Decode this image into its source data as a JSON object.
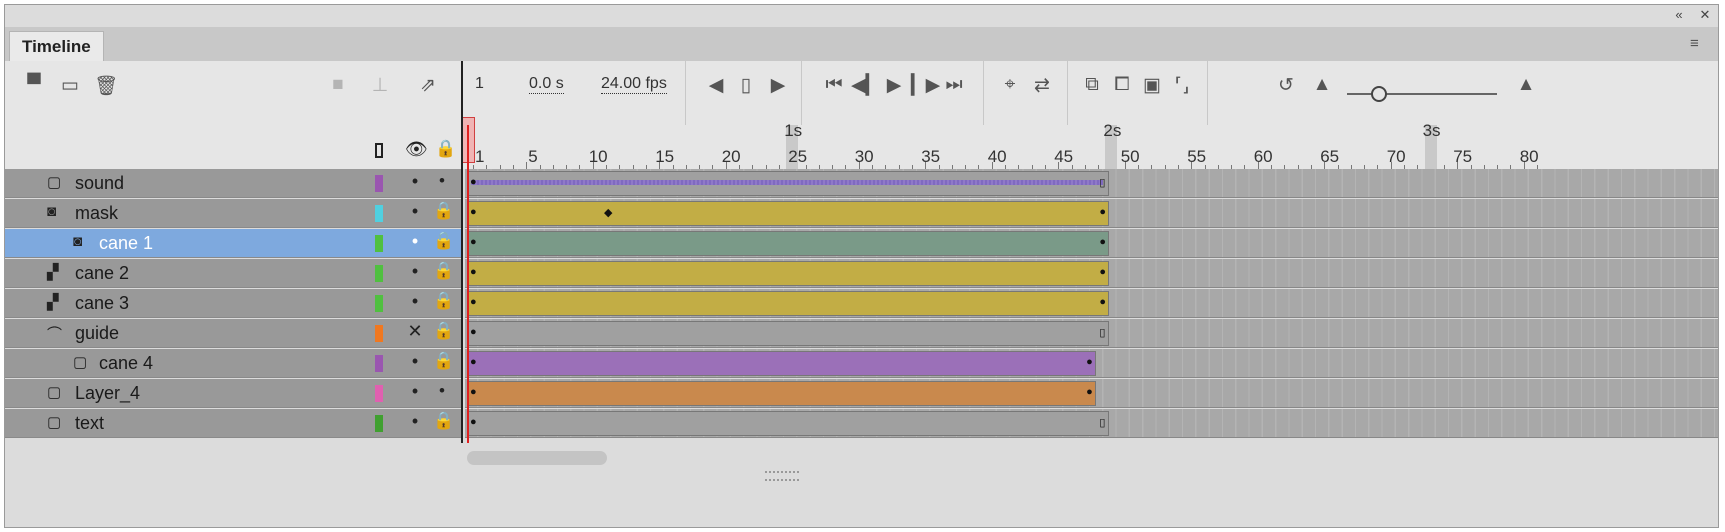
{
  "panel": {
    "tab_label": "Timeline"
  },
  "toolbar": {
    "left_icons": [
      "new-layer-icon",
      "new-folder-icon",
      "delete-icon"
    ],
    "disabled_icons": [
      "camera-icon",
      "parenting-icon",
      "graph-icon"
    ],
    "frame_number": "1",
    "time": "0.0 s",
    "fps": "24.00 fps",
    "playback_icons": [
      "step-back-icon",
      "loop-icon",
      "step-forward-icon",
      "first-frame-icon",
      "prev-frame-icon",
      "play-icon",
      "next-frame-icon",
      "last-frame-icon"
    ],
    "edit_icons": [
      "center-frame-icon",
      "loop-playback-icon",
      "onion-skin-icon",
      "onion-skin-outline-icon",
      "edit-multiple-icon",
      "onion-markers-icon"
    ],
    "zoom_icons": [
      "reset-zoom-icon",
      "zoom-small-icon",
      "zoom-large-icon"
    ],
    "zoom_level": 0.2
  },
  "header": {
    "columns": [
      "color",
      "visibility",
      "lock"
    ]
  },
  "ruler": {
    "frame_labels": [
      "1",
      "5",
      "10",
      "15",
      "20",
      "25",
      "30",
      "35",
      "40",
      "45",
      "50",
      "55",
      "60",
      "65",
      "70",
      "75",
      "80"
    ],
    "seconds": [
      "1s",
      "2s",
      "3s"
    ]
  },
  "layers": [
    {
      "name": "sound",
      "icon": "layer-icon",
      "color": "#9a56b0",
      "visibility": "•",
      "lock": "•",
      "selected": false,
      "indent": false,
      "span_color": "#a0a0a0",
      "wave": true,
      "end": 48
    },
    {
      "name": "mask",
      "icon": "mask-icon",
      "color": "#50d0e0",
      "visibility": "•",
      "lock": "lock",
      "selected": false,
      "indent": false,
      "span_color": "#c2ad45",
      "end": 48,
      "keyframes": [
        11
      ]
    },
    {
      "name": "cane 1",
      "icon": "masked-icon",
      "color": "#50c040",
      "visibility": "•",
      "lock": "lock",
      "selected": true,
      "indent": true,
      "span_color": "#7a9a88",
      "end": 48
    },
    {
      "name": "cane 2",
      "icon": "tween-layer-icon",
      "color": "#50c040",
      "visibility": "•",
      "lock": "lock",
      "selected": false,
      "indent": false,
      "span_color": "#c2ad45",
      "end": 48
    },
    {
      "name": "cane 3",
      "icon": "tween-layer-icon",
      "color": "#50c040",
      "visibility": "•",
      "lock": "lock",
      "selected": false,
      "indent": false,
      "span_color": "#c2ad45",
      "end": 48
    },
    {
      "name": "guide",
      "icon": "guide-icon",
      "color": "#f07820",
      "visibility": "✕",
      "lock": "lock",
      "selected": false,
      "indent": false,
      "span_color": "#a0a0a0",
      "end": 48
    },
    {
      "name": "cane 4",
      "icon": "layer-icon",
      "color": "#9a56b0",
      "visibility": "•",
      "lock": "lock",
      "selected": false,
      "indent": true,
      "span_color": "#9b70b8",
      "end": 47
    },
    {
      "name": "Layer_4",
      "icon": "layer-icon",
      "color": "#e060b0",
      "visibility": "•",
      "lock": "•",
      "selected": false,
      "indent": false,
      "span_color": "#c9894d",
      "end": 47
    },
    {
      "name": "text",
      "icon": "layer-icon",
      "color": "#40a030",
      "visibility": "•",
      "lock": "lock",
      "selected": false,
      "indent": false,
      "span_color": "#a0a0a0",
      "end": 48
    }
  ],
  "timeline": {
    "current_frame": 1,
    "total_frames": 48
  }
}
